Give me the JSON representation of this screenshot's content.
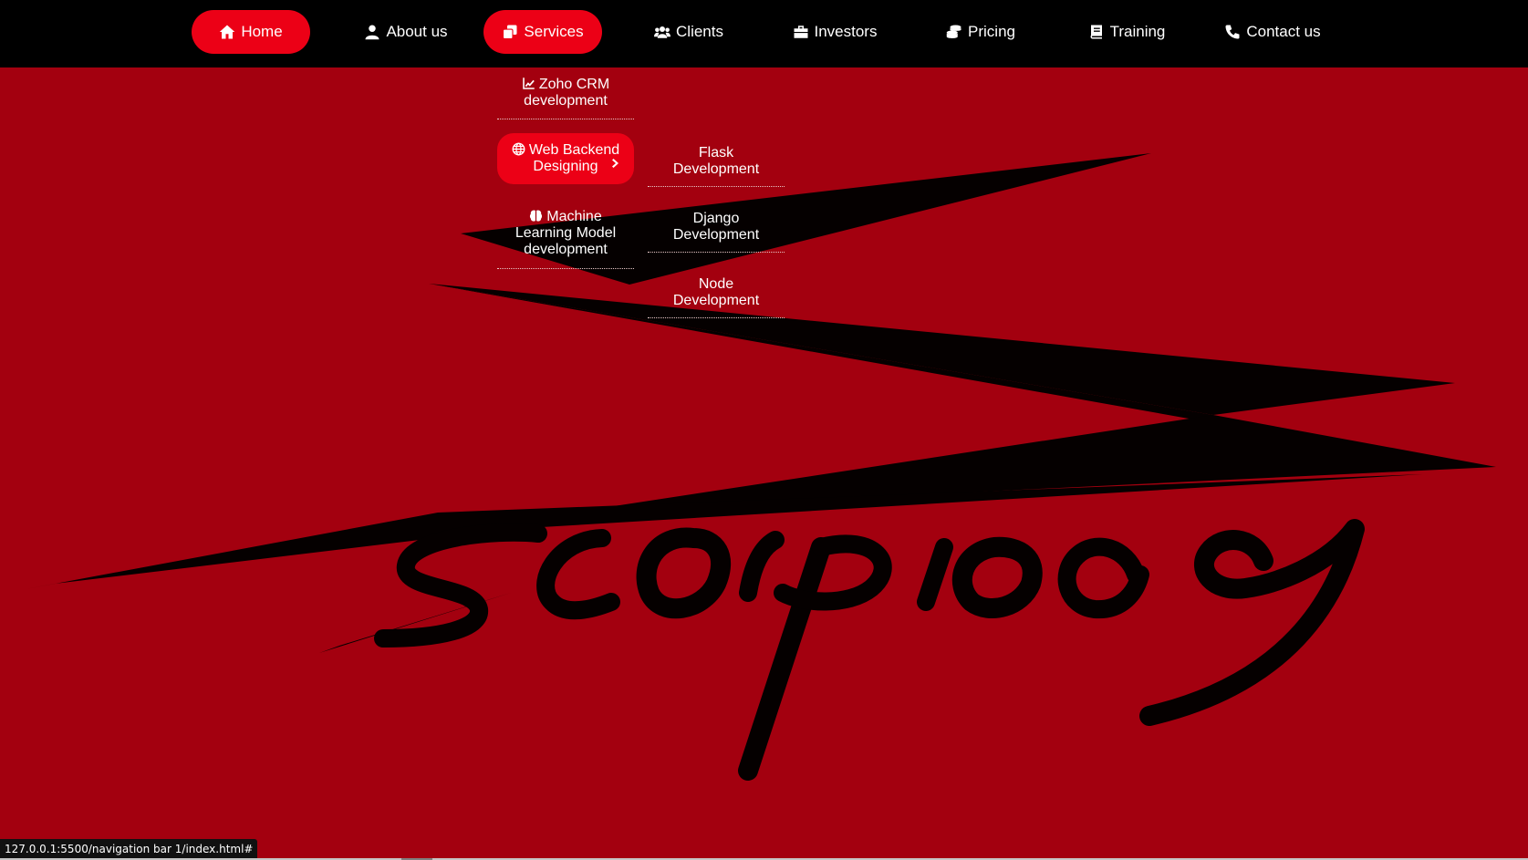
{
  "nav": {
    "items": [
      {
        "label": "Home",
        "icon": "home-icon",
        "active": true
      },
      {
        "label": "About us",
        "icon": "user-icon",
        "active": false
      },
      {
        "label": "Services",
        "icon": "clone-icon",
        "active": true
      },
      {
        "label": "Clients",
        "icon": "users-icon",
        "active": false
      },
      {
        "label": "Investors",
        "icon": "briefcase-icon",
        "active": false
      },
      {
        "label": "Pricing",
        "icon": "coins-icon",
        "active": false
      },
      {
        "label": "Training",
        "icon": "book-icon",
        "active": false
      },
      {
        "label": "Contact us",
        "icon": "phone-icon",
        "active": false
      }
    ]
  },
  "services_menu": {
    "items": [
      {
        "label_line1": "Zoho CRM",
        "label_line2": "development",
        "icon": "chart-line-icon"
      },
      {
        "label_line1": "Web Backend",
        "label_line2": "Designing",
        "icon": "globe-icon",
        "has_submenu": true
      },
      {
        "label_line1": "Machine",
        "label_line2": "Learning Model",
        "label_line3": "development",
        "icon": "brain-icon"
      }
    ]
  },
  "backend_submenu": {
    "items": [
      {
        "label_line1": "Flask",
        "label_line2": "Development"
      },
      {
        "label_line1": "Django",
        "label_line2": "Development"
      },
      {
        "label_line1": "Node",
        "label_line2": "Development"
      }
    ]
  },
  "status_bar": {
    "url": "127.0.0.1:5500/navigation bar 1/index.html#"
  },
  "colors": {
    "background": "#a3000f",
    "navbar": "#000000",
    "accent": "#ec0016"
  }
}
